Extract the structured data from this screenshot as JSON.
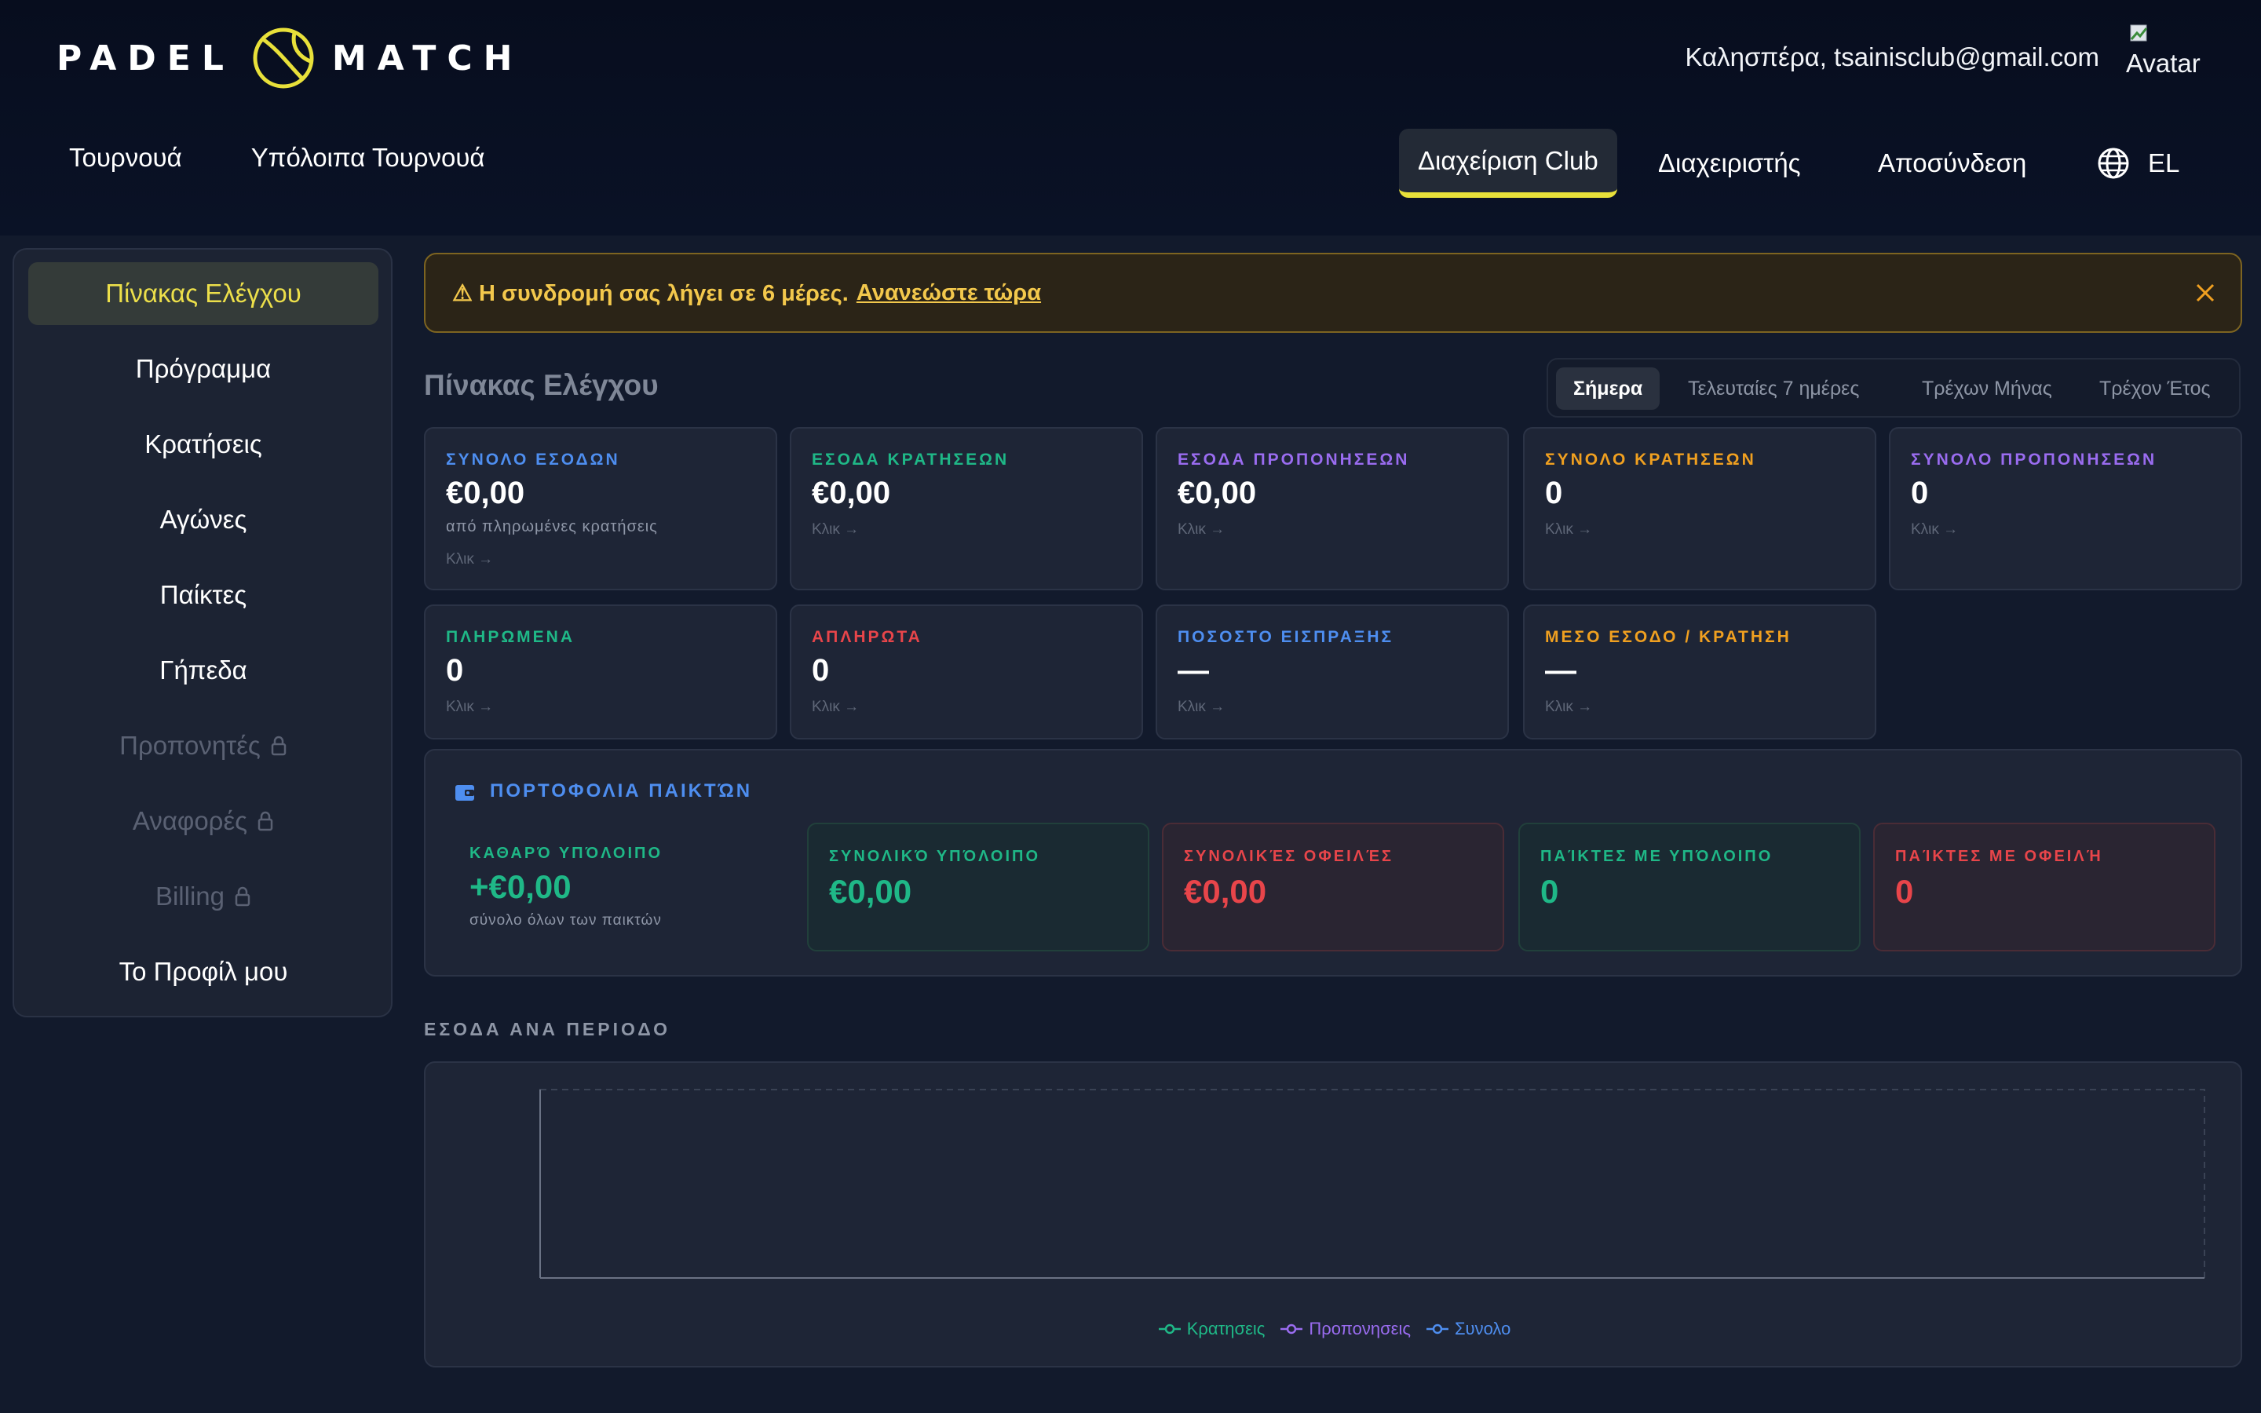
{
  "header": {
    "logo_left": "PADEL",
    "logo_right": "MATCH",
    "greeting": "Καλησπέρα, tsainisclub@gmail.com",
    "avatar_alt": "Avatar",
    "nav_left": [
      "Τουρνουά",
      "Υπόλοιπα Τουρνουά"
    ],
    "nav_right": {
      "club": "Διαχείριση Club",
      "admin": "Διαχειριστής",
      "logout": "Αποσύνδεση",
      "lang": "EL"
    }
  },
  "sidebar": {
    "items": [
      {
        "label": "Πίνακας Ελέγχου"
      },
      {
        "label": "Πρόγραμμα"
      },
      {
        "label": "Κρατήσεις"
      },
      {
        "label": "Αγώνες"
      },
      {
        "label": "Παίκτες"
      },
      {
        "label": "Γήπεδα"
      },
      {
        "label": "Προπονητές"
      },
      {
        "label": "Αναφορές"
      },
      {
        "label": "Billing"
      },
      {
        "label": "Το Προφίλ μου"
      }
    ]
  },
  "banner": {
    "text": "⚠ Η συνδρομή σας λήγει σε 6 μέρες.",
    "link": "Ανανεώστε τώρα"
  },
  "dashboard": {
    "title": "Πίνακας Ελέγχου",
    "tabs": [
      "Σήμερα",
      "Τελευταίες 7 ημέρες",
      "Τρέχων Μήνας",
      "Τρέχον Έτος"
    ],
    "click_label": "Κλικ →",
    "cards": [
      {
        "label": "ΣΥΝΟΛΟ ΕΣΟΔΩΝ",
        "value": "€0,00",
        "sub": "από πληρωμένες κρατήσεις",
        "color": "#4e8ef0"
      },
      {
        "label": "ΕΣΟΔΑ ΚΡΑΤΗΣΕΩΝ",
        "value": "€0,00",
        "color": "#1fb887"
      },
      {
        "label": "ΕΣΟΔΑ ΠΡΟΠΟΝΗΣΕΩΝ",
        "value": "€0,00",
        "color": "#9a6cf0"
      },
      {
        "label": "ΣΥΝΟΛΟ ΚΡΑΤΗΣΕΩΝ",
        "value": "0",
        "color": "#f0a020"
      },
      {
        "label": "ΣΥΝΟΛΟ ΠΡΟΠΟΝΗΣΕΩΝ",
        "value": "0",
        "color": "#9a6cf0"
      },
      {
        "label": "ΠΛΗΡΩΜΕΝΑ",
        "value": "0",
        "color": "#1fb887"
      },
      {
        "label": "ΑΠΛΗΡΩΤΑ",
        "value": "0",
        "color": "#e8454a"
      },
      {
        "label": "ΠΟΣΟΣΤΟ ΕΙΣΠΡΑΞΗΣ",
        "value": "—",
        "color": "#4e8ef0"
      },
      {
        "label": "ΜΕΣΟ ΕΣΟΔΟ / ΚΡΑΤΗΣΗ",
        "value": "—",
        "color": "#f0a020"
      }
    ]
  },
  "portfolio": {
    "title": "ΠΟΡΤΟΦΟΛΙΑ ΠΑΙΚΤΏΝ",
    "net_label": "ΚΑΘΑΡΌ ΥΠΌΛΟΙΠΟ",
    "net_value": "+€0,00",
    "net_sub": "σύνολο όλων των παικτών",
    "boxes": [
      {
        "label": "ΣΥΝΟΛΙΚΌ ΥΠΌΛΟΙΠΟ",
        "value": "€0,00",
        "color": "#1fb887"
      },
      {
        "label": "ΣΥΝΟΛΙΚΈΣ ΟΦΕΙΛΈΣ",
        "value": "€0,00",
        "color": "#e8454a"
      },
      {
        "label": "ΠΑΊΚΤΕΣ ΜΕ ΥΠΌΛΟΙΠΟ",
        "value": "0",
        "color": "#1fb887"
      },
      {
        "label": "ΠΑΊΚΤΕΣ ΜΕ ΟΦΕΙΛΉ",
        "value": "0",
        "color": "#e8454a"
      }
    ]
  },
  "chart_data": {
    "type": "line",
    "title": "ΕΣΟΔΑ ΑΝΑ ΠΕΡΙΟΔΟ",
    "x": [],
    "series": [
      {
        "name": "Κρατησεις",
        "color": "#1fb887",
        "values": []
      },
      {
        "name": "Προπονησεις",
        "color": "#9a6cf0",
        "values": []
      },
      {
        "name": "Συνολο",
        "color": "#4e8ef0",
        "values": []
      }
    ],
    "grid": true,
    "legend": "bottom"
  }
}
